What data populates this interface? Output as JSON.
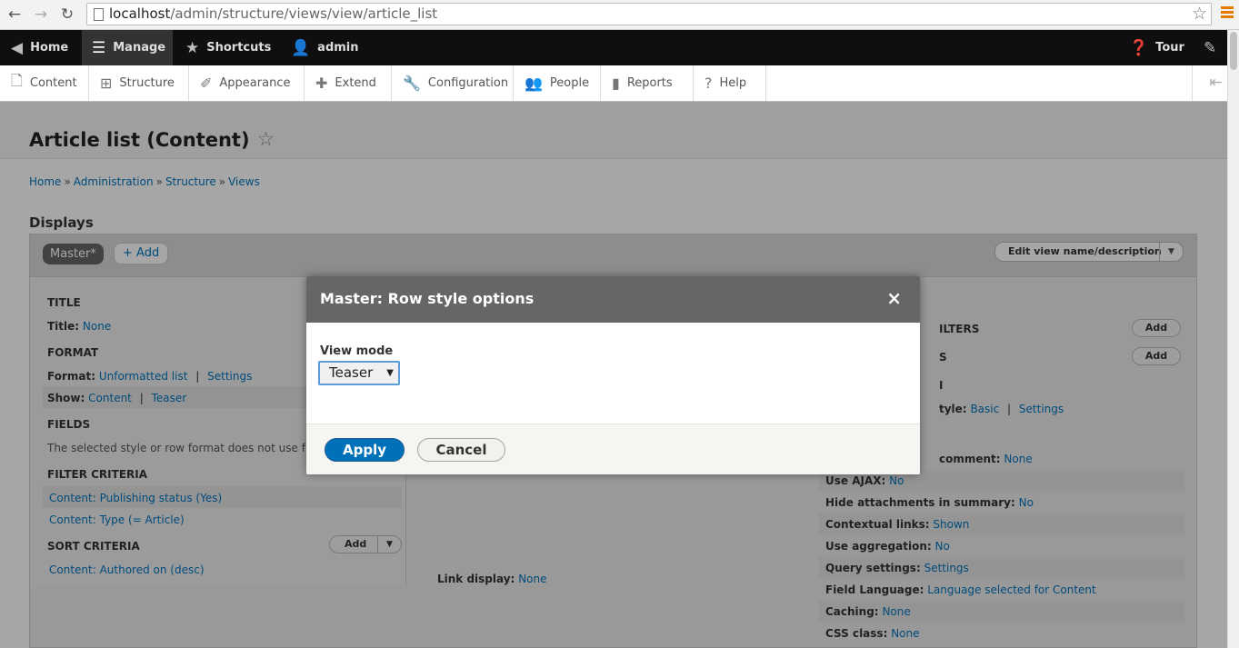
{
  "browser": {
    "url_host": "localhost",
    "url_path": "/admin/structure/views/view/article_list"
  },
  "toolbar": {
    "home": "Home",
    "manage": "Manage",
    "shortcuts": "Shortcuts",
    "user": "admin",
    "tour": "Tour"
  },
  "tray": {
    "items": [
      "Content",
      "Structure",
      "Appearance",
      "Extend",
      "Configuration",
      "People",
      "Reports",
      "Help"
    ]
  },
  "page": {
    "title": "Article list (Content)",
    "breadcrumb": [
      "Home",
      "Administration",
      "Structure",
      "Views"
    ],
    "breadcrumb_sep": "»",
    "displays_heading": "Displays",
    "master_tab": "Master*",
    "add_display": "+ Add",
    "edit_view_button": "Edit view name/description"
  },
  "left_col": {
    "title_h": "TITLE",
    "title_label": "Title:",
    "title_value": "None",
    "format_h": "FORMAT",
    "format_label": "Format:",
    "format_value": "Unformatted list",
    "format_settings": "Settings",
    "show_label": "Show:",
    "show_value": "Content",
    "show_mode": "Teaser",
    "pipe": "|",
    "fields_h": "FIELDS",
    "fields_note": "The selected style or row format does not use f",
    "filter_h": "FILTER CRITERIA",
    "filter_1": "Content: Publishing status (Yes)",
    "filter_2": "Content: Type (= Article)",
    "sort_h": "SORT CRITERIA",
    "sort_add": "Add",
    "sort_1": "Content: Authored on (desc)"
  },
  "mid_col": {
    "link_display_label": "Link display:",
    "link_display_value": "None"
  },
  "right_col": {
    "filters_h_partial": "ILTERS",
    "filters_add": "Add",
    "sorts_h_partial": "S",
    "sorts_add": "Add",
    "third_h_partial": "I",
    "pager_label_partial": "tyle:",
    "pager_value": "Basic",
    "pager_settings": "Settings",
    "comment_label_partial": "comment:",
    "comment_value": "None",
    "rows": [
      {
        "label": "Use AJAX:",
        "value": "No"
      },
      {
        "label": "Hide attachments in summary:",
        "value": "No"
      },
      {
        "label": "Contextual links:",
        "value": "Shown"
      },
      {
        "label": "Use aggregation:",
        "value": "No"
      },
      {
        "label": "Query settings:",
        "value": "Settings"
      },
      {
        "label": "Field Language:",
        "value": "Language selected for Content"
      },
      {
        "label": "Caching:",
        "value": "None"
      },
      {
        "label": "CSS class:",
        "value": "None"
      }
    ]
  },
  "dialog": {
    "title": "Master: Row style options",
    "close": "×",
    "field_label": "View mode",
    "select_value": "Teaser",
    "apply": "Apply",
    "cancel": "Cancel"
  }
}
